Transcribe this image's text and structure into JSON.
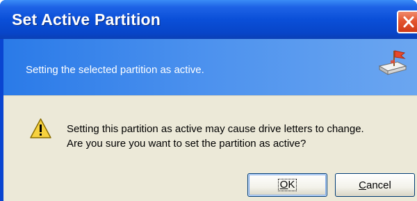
{
  "window": {
    "title": "Set Active Partition"
  },
  "header": {
    "text": "Setting the selected partition as active.",
    "icon": "partition-manager-icon"
  },
  "message": {
    "icon": "warning-icon",
    "line1": "Setting this partition as active may cause drive letters to change.",
    "line2": "Are you sure you want to set the partition as active?"
  },
  "buttons": {
    "ok": {
      "underlined": "O",
      "rest": "K"
    },
    "cancel": {
      "underlined": "C",
      "rest": "ancel"
    }
  },
  "colors": {
    "titlebar": "#0a4fd8",
    "header_band": "#4d92ee",
    "dialog_bg": "#ece9d8",
    "close_button": "#e3552f"
  }
}
